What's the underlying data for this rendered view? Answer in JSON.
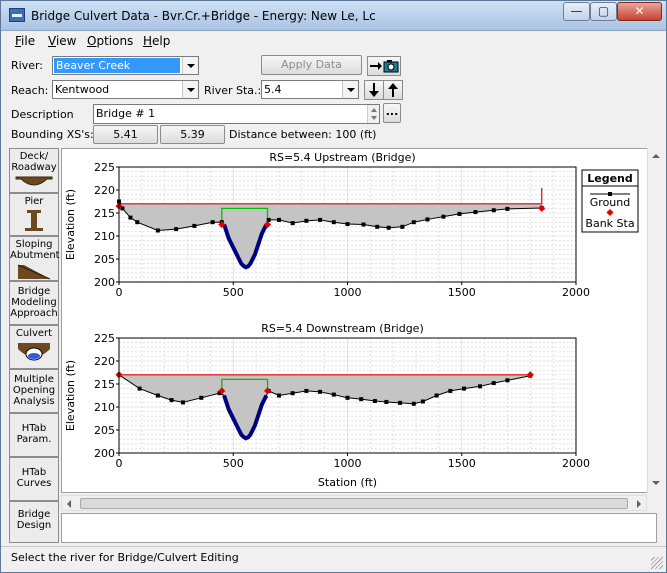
{
  "window": {
    "title": "Bridge Culvert Data - Bvr.Cr.+Bridge - Energy: New Le, Lc",
    "controls": {
      "minimize": "—",
      "maximize": "▢",
      "close": "✕"
    }
  },
  "menu": [
    {
      "label": "File",
      "key": "F"
    },
    {
      "label": "View",
      "key": "V"
    },
    {
      "label": "Options",
      "key": "O"
    },
    {
      "label": "Help",
      "key": "H"
    }
  ],
  "form": {
    "river_label": "River:",
    "river_value": "Beaver Creek",
    "apply_label": "Apply Data",
    "reach_label": "Reach:",
    "reach_value": "Kentwood",
    "river_sta_label": "River Sta.:",
    "river_sta_value": "5.4",
    "description_label": "Description",
    "description_value": "Bridge # 1",
    "bounding_label": "Bounding XS's:",
    "bounding_us": "5.41",
    "bounding_ds": "5.39",
    "distance_label": "Distance between: 100 (ft)",
    "ellipsis": "..."
  },
  "sidebar": [
    {
      "label": "Deck/\nRoadway",
      "icon": "deck-icon"
    },
    {
      "label": "Pier",
      "icon": "pier-icon"
    },
    {
      "label": "Sloping\nAbutment",
      "icon": "abutment-icon"
    },
    {
      "label": "Bridge\nModeling\nApproach",
      "icon": ""
    },
    {
      "label": "Culvert",
      "icon": "culvert-icon"
    },
    {
      "label": "Multiple\nOpening\nAnalysis",
      "icon": ""
    },
    {
      "label": "HTab\nParam.",
      "icon": ""
    },
    {
      "label": "HTab\nCurves",
      "icon": ""
    },
    {
      "label": "Bridge\nDesign",
      "icon": ""
    }
  ],
  "status": "Select the river for Bridge/Culvert Editing",
  "colors": {
    "ground": "#000000",
    "bank_sta": "#e00000",
    "deck_top": "#e00000",
    "deck": "#00c000",
    "culvert": "#00007f",
    "fill": "#c4c4c4"
  },
  "chart_data": [
    {
      "type": "line",
      "title": "RS=5.4    Upstream  (Bridge)",
      "xlabel": "",
      "ylabel": "Elevation (ft)",
      "xlim": [
        0,
        2000
      ],
      "ylim": [
        200,
        225
      ],
      "xticks": [
        0,
        500,
        1000,
        1500,
        2000
      ],
      "yticks": [
        200,
        205,
        210,
        215,
        220,
        225
      ],
      "legend": {
        "title": "Legend",
        "entries": [
          "Ground",
          "Bank Sta"
        ],
        "placement": "right"
      },
      "ground": [
        [
          0,
          217.5
        ],
        [
          15,
          216
        ],
        [
          50,
          214
        ],
        [
          80,
          213
        ],
        [
          170,
          211.2
        ],
        [
          250,
          211.5
        ],
        [
          330,
          212.2
        ],
        [
          410,
          213
        ],
        [
          450,
          213
        ],
        [
          460,
          212.5
        ],
        [
          470,
          211
        ],
        [
          480,
          209.5
        ],
        [
          495,
          208
        ],
        [
          505,
          207
        ],
        [
          515,
          206
        ],
        [
          525,
          205
        ],
        [
          535,
          204
        ],
        [
          545,
          203.5
        ],
        [
          555,
          203.2
        ],
        [
          565,
          203.4
        ],
        [
          575,
          204
        ],
        [
          585,
          205
        ],
        [
          595,
          206
        ],
        [
          605,
          207.5
        ],
        [
          615,
          209
        ],
        [
          625,
          210.5
        ],
        [
          635,
          211.5
        ],
        [
          645,
          212.5
        ],
        [
          655,
          213.5
        ],
        [
          700,
          213.5
        ],
        [
          760,
          212.8
        ],
        [
          820,
          213.3
        ],
        [
          880,
          213.5
        ],
        [
          940,
          213
        ],
        [
          1000,
          212.6
        ],
        [
          1070,
          212.5
        ],
        [
          1130,
          212
        ],
        [
          1180,
          211.8
        ],
        [
          1240,
          212
        ],
        [
          1290,
          213
        ],
        [
          1350,
          213.6
        ],
        [
          1420,
          214.2
        ],
        [
          1490,
          214.8
        ],
        [
          1560,
          215.2
        ],
        [
          1640,
          215.6
        ],
        [
          1700,
          215.9
        ],
        [
          1850,
          216.1
        ]
      ],
      "bank_sta": [
        [
          0,
          216.5
        ],
        [
          450,
          212.5
        ],
        [
          650,
          212.5
        ],
        [
          1850,
          216
        ]
      ],
      "deck_top": [
        [
          0,
          217
        ],
        [
          1850,
          217
        ],
        [
          1850,
          220.5
        ]
      ],
      "deck": [
        [
          450,
          216
        ],
        [
          650,
          216
        ],
        [
          650,
          213
        ],
        [
          450,
          213
        ]
      ]
    },
    {
      "type": "line",
      "title": "RS=5.4    Downstream  (Bridge)",
      "xlabel": "Station (ft)",
      "ylabel": "Elevation (ft)",
      "xlim": [
        0,
        2000
      ],
      "ylim": [
        200,
        225
      ],
      "xticks": [
        0,
        500,
        1000,
        1500,
        2000
      ],
      "yticks": [
        200,
        205,
        210,
        215,
        220,
        225
      ],
      "ground": [
        [
          0,
          217
        ],
        [
          90,
          214
        ],
        [
          170,
          212.5
        ],
        [
          230,
          211.5
        ],
        [
          280,
          211
        ],
        [
          360,
          212
        ],
        [
          440,
          213
        ],
        [
          460,
          212.5
        ],
        [
          470,
          211
        ],
        [
          480,
          209.5
        ],
        [
          495,
          208
        ],
        [
          505,
          207
        ],
        [
          515,
          206
        ],
        [
          525,
          205
        ],
        [
          535,
          204
        ],
        [
          545,
          203.5
        ],
        [
          555,
          203.2
        ],
        [
          565,
          203.4
        ],
        [
          575,
          204
        ],
        [
          585,
          205
        ],
        [
          595,
          206
        ],
        [
          605,
          207.5
        ],
        [
          615,
          209
        ],
        [
          625,
          210.5
        ],
        [
          635,
          211.5
        ],
        [
          645,
          212.5
        ],
        [
          655,
          213.5
        ],
        [
          700,
          212.5
        ],
        [
          760,
          213
        ],
        [
          820,
          213.5
        ],
        [
          880,
          213.3
        ],
        [
          940,
          212.7
        ],
        [
          1000,
          212
        ],
        [
          1060,
          211.7
        ],
        [
          1120,
          211.3
        ],
        [
          1170,
          211.1
        ],
        [
          1230,
          210.9
        ],
        [
          1290,
          210.7
        ],
        [
          1330,
          211.2
        ],
        [
          1390,
          212.5
        ],
        [
          1450,
          213.5
        ],
        [
          1510,
          214
        ],
        [
          1580,
          214.5
        ],
        [
          1640,
          215.2
        ],
        [
          1700,
          215.8
        ],
        [
          1800,
          216.8
        ]
      ],
      "bank_sta": [
        [
          0,
          217
        ],
        [
          450,
          213.5
        ],
        [
          650,
          213.5
        ],
        [
          1800,
          217
        ]
      ],
      "deck_top": [
        [
          0,
          217
        ],
        [
          1800,
          217
        ]
      ],
      "deck": [
        [
          450,
          216
        ],
        [
          650,
          216
        ],
        [
          650,
          213
        ],
        [
          450,
          213
        ]
      ]
    }
  ]
}
